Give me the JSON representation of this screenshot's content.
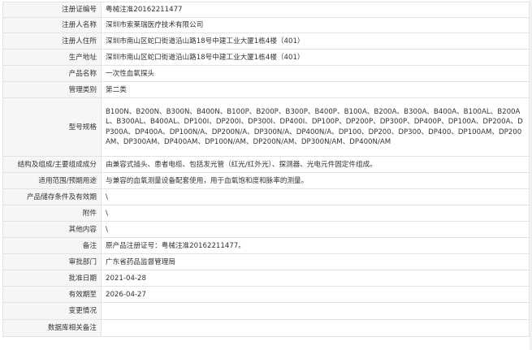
{
  "rows": [
    {
      "label": "注册证编号",
      "value": "粤械注准20162211477"
    },
    {
      "label": "注册人名称",
      "value": "深圳市索莱瑞医疗技术有限公司"
    },
    {
      "label": "注册人住所",
      "value": "深圳市南山区蛇口街道沿山路18号中建工业大厦1栋4楼（401）"
    },
    {
      "label": "生产地址",
      "value": "深圳市南山区蛇口街道沿山路18号中建工业大厦1栋4楼（401）"
    },
    {
      "label": "产品名称",
      "value": "一次性血氧探头"
    },
    {
      "label": "管理类别",
      "value": "第二类"
    },
    {
      "label": "型号规格",
      "value": "B100N、B200N、B300N、B400N、B100P、B200P、B300P、B400P、B100A、B200A、B300A、B400A、B100AL、B200AL、B300AL、B400AL、DP100I、DP200I、DP300I、DP400I、DP100P、DP200P、DP300P、DP400P、DP100A、DP200A、DP300A、DP400A、DP100N/A、DP200N/A、DP300N/A、DP400N/A、DP100、DP200、DP300、DP400、DP100AM、DP200AM、DP300AM、DP400AM、DP100N/AM、DP200N/AM、DP300N/AM、DP400N/AM"
    },
    {
      "label": "结构及组成/主要组成成分",
      "value": "由兼容式插头、患者电缆、包括发光管（红光/红外光）、探测器、光电元件固定件组成。"
    },
    {
      "label": "适用范围/预期用途",
      "value": "与兼容的血氧测量设备配套使用，用于血氧饱和度和脉率的测量。"
    },
    {
      "label": "产品储存条件及有效期",
      "value": "\\"
    },
    {
      "label": "附件",
      "value": "\\"
    },
    {
      "label": "其他内容",
      "value": "\\"
    },
    {
      "label": "备注",
      "value": "原产品注册证号：粤械注准20162211477。"
    },
    {
      "label": "审批部门",
      "value": "广东省药品监督管理局"
    },
    {
      "label": "批准日期",
      "value": "2021-04-28"
    },
    {
      "label": "有效期至",
      "value": "2026-04-27"
    },
    {
      "label": "变更情况",
      "value": ""
    },
    {
      "label": "数据库相关备注",
      "value": ""
    }
  ]
}
